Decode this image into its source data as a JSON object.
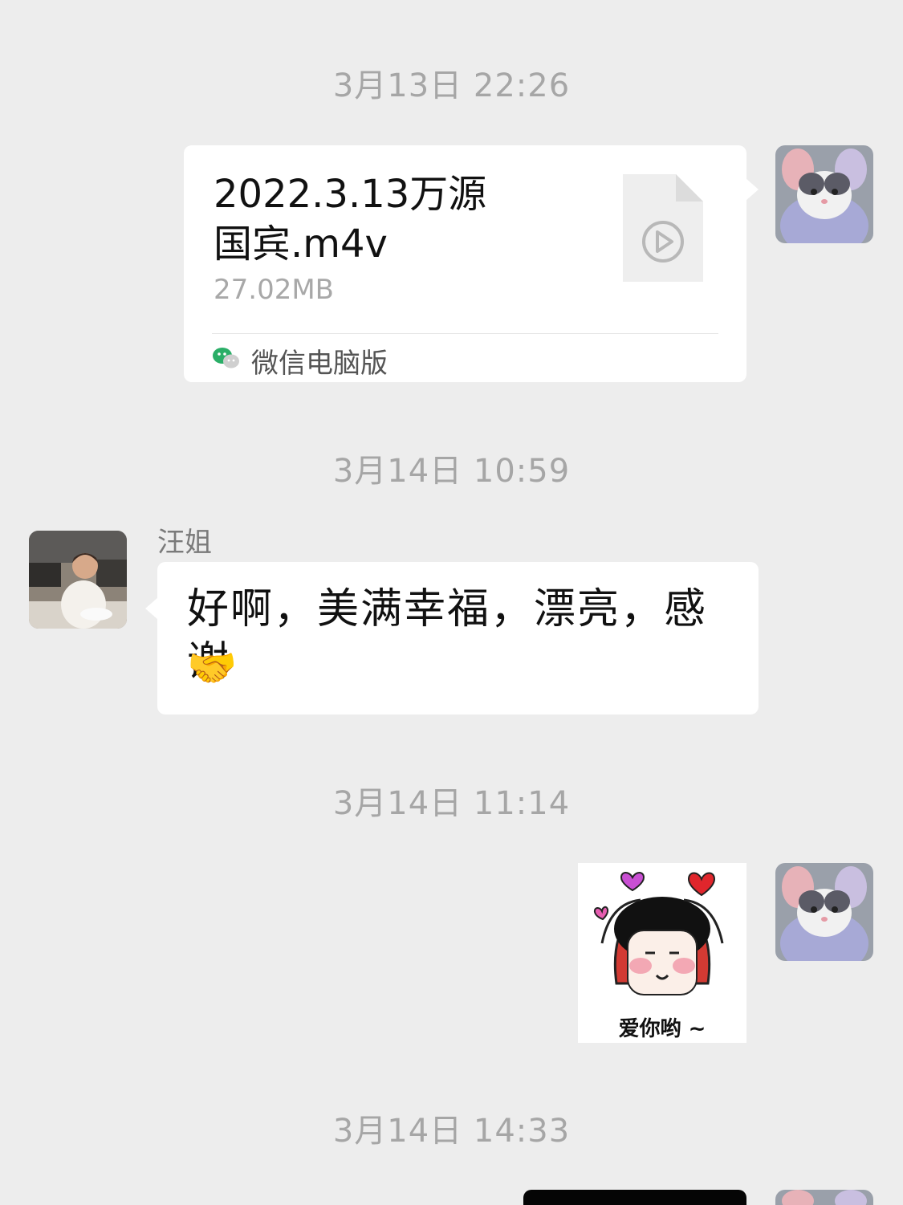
{
  "messages": [
    {
      "timestamp": "3月13日 22:26",
      "type": "file",
      "file_name": "2022.3.13万源国宾.m4v",
      "file_size": "27.02MB",
      "source": "微信电脑版"
    },
    {
      "timestamp": "3月14日 10:59",
      "type": "text",
      "sender": "汪姐",
      "text": "好啊，美满幸福，漂亮，感谢",
      "emoji": "🤝"
    },
    {
      "timestamp": "3月14日 11:14",
      "type": "sticker",
      "sticker_caption": "爱你哟 ~"
    },
    {
      "timestamp": "3月14日 14:33",
      "type": "partial"
    }
  ],
  "icons": {
    "file": "video-file-icon",
    "source": "wechat-icon",
    "emoji": "handshake-icon"
  },
  "colors": {
    "background": "#ededed",
    "bubble": "#ffffff",
    "timestamp": "#a6a6a6",
    "wechat_green": "#2aae67"
  }
}
